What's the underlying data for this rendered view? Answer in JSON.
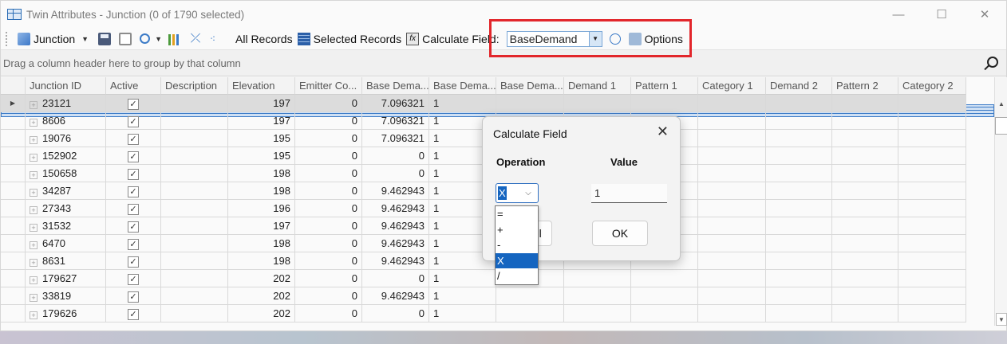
{
  "window": {
    "title": "Twin Attributes - Junction (0 of 1790 selected)",
    "controls": {
      "minimize": "—",
      "maximize": "☐",
      "close": "✕"
    }
  },
  "toolbar": {
    "layer": "Junction",
    "all_records": "All Records",
    "selected_records": "Selected Records",
    "calculate_field_label": "Calculate Field:",
    "calculate_field_value": "BaseDemand",
    "options": "Options",
    "highlight_color": "#e2262b"
  },
  "group_panel": {
    "hint": "Drag a column header here to group by that column"
  },
  "grid": {
    "columns": [
      "Junction ID",
      "Active",
      "Description",
      "Elevation",
      "Emitter Co...",
      "Base Dema...",
      "Base Dema...",
      "Base Dema...",
      "Demand 1",
      "Pattern 1",
      "Category 1",
      "Demand 2",
      "Pattern 2",
      "Category 2"
    ],
    "rows": [
      {
        "id": "23121",
        "active": "✓",
        "elevation": "197",
        "emitter": "0",
        "base1": "7.096321",
        "base2": "1"
      },
      {
        "id": "8606",
        "active": "✓",
        "elevation": "197",
        "emitter": "0",
        "base1": "7.096321",
        "base2": "1"
      },
      {
        "id": "19076",
        "active": "✓",
        "elevation": "195",
        "emitter": "0",
        "base1": "7.096321",
        "base2": "1"
      },
      {
        "id": "152902",
        "active": "✓",
        "elevation": "195",
        "emitter": "0",
        "base1": "0",
        "base2": "1"
      },
      {
        "id": "150658",
        "active": "✓",
        "elevation": "198",
        "emitter": "0",
        "base1": "0",
        "base2": "1"
      },
      {
        "id": "34287",
        "active": "✓",
        "elevation": "198",
        "emitter": "0",
        "base1": "9.462943",
        "base2": "1"
      },
      {
        "id": "27343",
        "active": "✓",
        "elevation": "196",
        "emitter": "0",
        "base1": "9.462943",
        "base2": "1"
      },
      {
        "id": "31532",
        "active": "✓",
        "elevation": "197",
        "emitter": "0",
        "base1": "9.462943",
        "base2": "1"
      },
      {
        "id": "6470",
        "active": "✓",
        "elevation": "198",
        "emitter": "0",
        "base1": "9.462943",
        "base2": "1"
      },
      {
        "id": "8631",
        "active": "✓",
        "elevation": "198",
        "emitter": "0",
        "base1": "9.462943",
        "base2": "1"
      },
      {
        "id": "179627",
        "active": "✓",
        "elevation": "202",
        "emitter": "0",
        "base1": "0",
        "base2": "1"
      },
      {
        "id": "33819",
        "active": "✓",
        "elevation": "202",
        "emitter": "0",
        "base1": "9.462943",
        "base2": "1"
      },
      {
        "id": "179626",
        "active": "✓",
        "elevation": "202",
        "emitter": "0",
        "base1": "0",
        "base2": "1"
      }
    ]
  },
  "dialog": {
    "title": "Calculate Field",
    "operation_label": "Operation",
    "value_label": "Value",
    "operation_value": "X",
    "value": "1",
    "cancel": "Cancel",
    "ok": "OK",
    "operations": [
      "=",
      "+",
      "-",
      "X",
      "/"
    ],
    "selected_operation": "X"
  }
}
